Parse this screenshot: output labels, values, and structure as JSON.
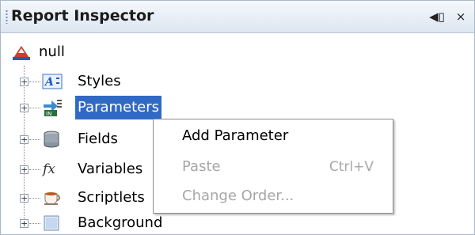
{
  "panel": {
    "title": "Report Inspector",
    "buttons": {
      "pin": "◀▯",
      "close": "×"
    }
  },
  "tree": {
    "root": {
      "label": "null",
      "icon": "report-icon"
    },
    "items": [
      {
        "label": "Styles",
        "icon": "styles-icon",
        "selected": false
      },
      {
        "label": "Parameters",
        "icon": "parameters-icon",
        "selected": true
      },
      {
        "label": "Fields",
        "icon": "fields-icon",
        "selected": false
      },
      {
        "label": "Variables",
        "icon": "variables-icon",
        "selected": false
      },
      {
        "label": "Scriptlets",
        "icon": "scriptlets-icon",
        "selected": false
      },
      {
        "label": "Background",
        "icon": "background-icon",
        "selected": false
      }
    ]
  },
  "context_menu": {
    "items": [
      {
        "label": "Add Parameter",
        "enabled": true,
        "shortcut": ""
      },
      {
        "label": "Paste",
        "enabled": false,
        "shortcut": "Ctrl+V"
      },
      {
        "label": "Change Order...",
        "enabled": false,
        "shortcut": ""
      }
    ]
  },
  "colors": {
    "selection": "#316ac5",
    "disabled_text": "#a7a7a7"
  }
}
